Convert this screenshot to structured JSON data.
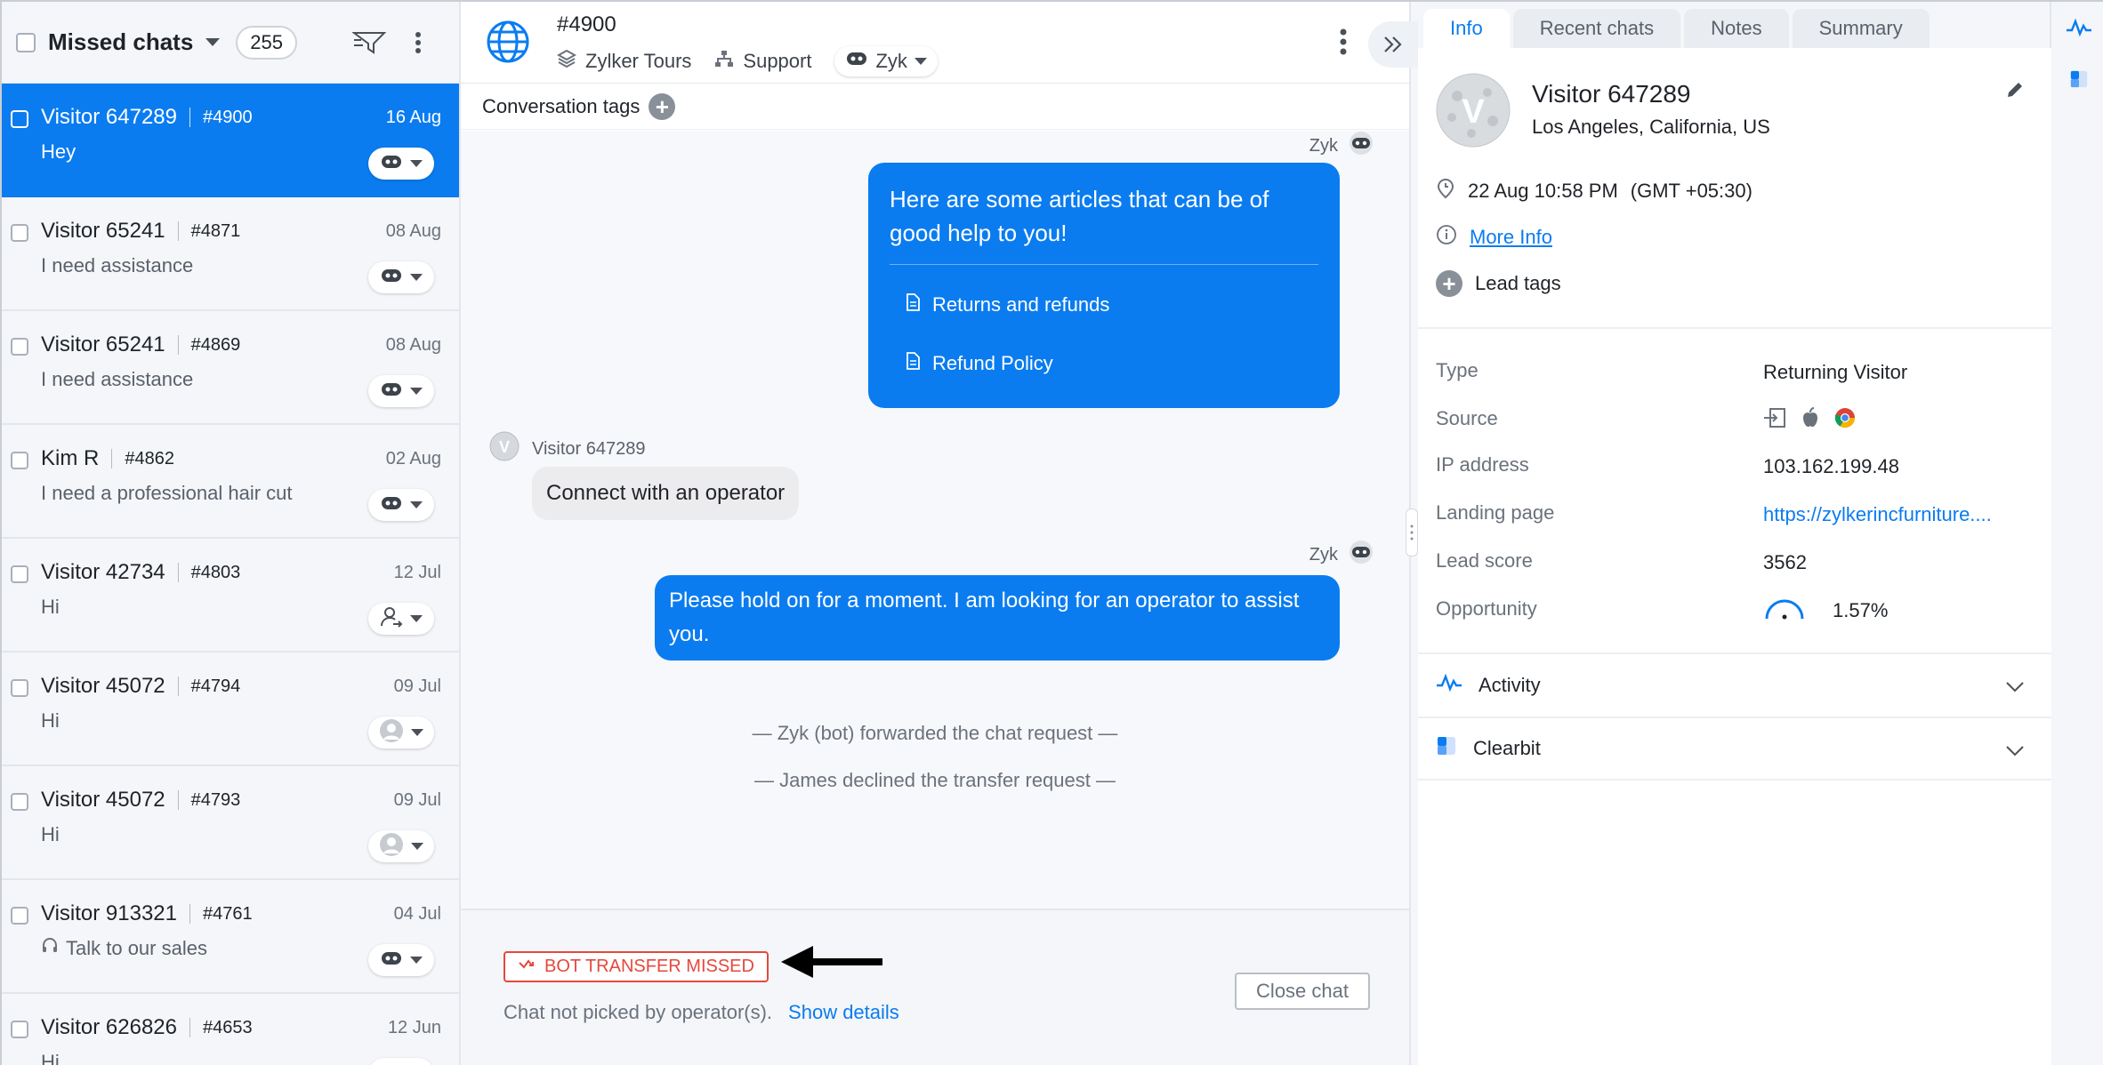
{
  "colors": {
    "accent": "#0a7cf0",
    "danger": "#e5483d",
    "panel_bg": "#f4f6f9"
  },
  "left": {
    "title": "Missed chats",
    "count": "255",
    "chats": [
      {
        "name": "Visitor 647289",
        "id": "#4900",
        "date": "16 Aug",
        "message": "Hey",
        "assignee": "bot-icon",
        "active": true
      },
      {
        "name": "Visitor 65241",
        "id": "#4871",
        "date": "08 Aug",
        "message": "I need assistance",
        "assignee": "bot-icon"
      },
      {
        "name": "Visitor 65241",
        "id": "#4869",
        "date": "08 Aug",
        "message": "I need assistance",
        "assignee": "bot-icon"
      },
      {
        "name": "Kim R",
        "id": "#4862",
        "date": "02 Aug",
        "message": "I need a professional hair cut",
        "assignee": "bot-icon"
      },
      {
        "name": "Visitor 42734",
        "id": "#4803",
        "date": "12 Jul",
        "message": "Hi",
        "assignee": "user-outline-icon"
      },
      {
        "name": "Visitor 45072",
        "id": "#4794",
        "date": "09 Jul",
        "message": "Hi",
        "assignee": "user-avatar-icon"
      },
      {
        "name": "Visitor 45072",
        "id": "#4793",
        "date": "09 Jul",
        "message": "Hi",
        "assignee": "user-avatar-icon"
      },
      {
        "name": "Visitor 913321",
        "id": "#4761",
        "date": "04 Jul",
        "message": "Talk to our sales",
        "assignee": "bot-icon",
        "msg_icon": "headset-icon"
      },
      {
        "name": "Visitor 626826",
        "id": "#4653",
        "date": "12 Jun",
        "message": "Hi",
        "assignee": "bot-icon"
      }
    ]
  },
  "conversation": {
    "id": "#4900",
    "brand": "Zylker Tours",
    "department": "Support",
    "bot_name": "Zyk",
    "tags_label": "Conversation tags",
    "bot_sender": "Zyk",
    "articles_intro": "Here are some articles that can be of good help to you!",
    "articles": [
      "Returns and refunds",
      "Refund Policy"
    ],
    "visitor_sender": "Visitor 647289",
    "visitor_message": "Connect with an operator",
    "hold_message": "Please hold on for a moment. I am looking for an operator to assist you.",
    "system_messages": [
      "Zyk (bot) forwarded the chat request",
      "James declined the transfer request"
    ],
    "missed_badge": "BOT TRANSFER MISSED",
    "footer_note": "Chat not picked by operator(s).",
    "show_details": "Show details",
    "close_chat": "Close chat"
  },
  "info": {
    "tabs": [
      "Info",
      "Recent chats",
      "Notes",
      "Summary"
    ],
    "visitor_name": "Visitor 647289",
    "location": "Los Angeles, California, US",
    "avatar_letter": "V",
    "time": "22 Aug 10:58 PM",
    "timezone": "(GMT +05:30)",
    "more_info": "More Info",
    "lead_tags": "Lead tags",
    "fields": {
      "type_label": "Type",
      "type_value": "Returning Visitor",
      "source_label": "Source",
      "ip_label": "IP address",
      "ip_value": "103.162.199.48",
      "landing_label": "Landing page",
      "landing_value": "https://zylkerincfurniture....",
      "score_label": "Lead score",
      "score_value": "3562",
      "opp_label": "Opportunity",
      "opp_value": "1.57%"
    },
    "sections": [
      "Activity",
      "Clearbit"
    ]
  }
}
